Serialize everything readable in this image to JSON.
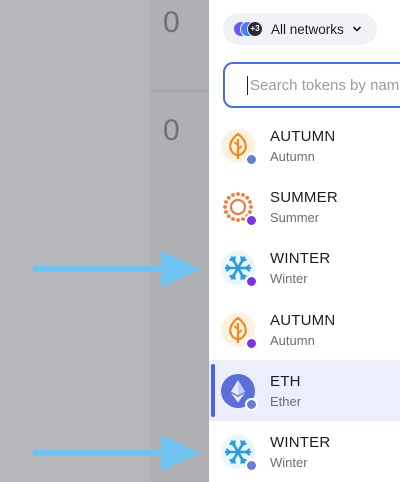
{
  "background": {
    "cells": [
      "0",
      "0"
    ]
  },
  "network_selector": {
    "badge_count": "+3",
    "label": "All networks"
  },
  "search": {
    "placeholder": "Search tokens by name"
  },
  "tokens": [
    {
      "symbol": "AUTUMN",
      "name": "Autumn",
      "icon": "autumn-leaf-icon",
      "chain": "eth",
      "selected": false
    },
    {
      "symbol": "SUMMER",
      "name": "Summer",
      "icon": "summer-sun-icon",
      "chain": "purple",
      "selected": false
    },
    {
      "symbol": "WINTER",
      "name": "Winter",
      "icon": "winter-snowflake-icon",
      "chain": "purple",
      "selected": false
    },
    {
      "symbol": "AUTUMN",
      "name": "Autumn",
      "icon": "autumn-leaf-icon",
      "chain": "purple",
      "selected": false
    },
    {
      "symbol": "ETH",
      "name": "Ether",
      "icon": "ethereum-icon",
      "chain": "eth",
      "selected": true
    },
    {
      "symbol": "WINTER",
      "name": "Winter",
      "icon": "winter-snowflake-icon",
      "chain": "eth",
      "selected": false
    }
  ],
  "colors": {
    "accent": "#4a62e8",
    "arrow": "#6ec3f0",
    "selected_bg": "#eceefc"
  }
}
